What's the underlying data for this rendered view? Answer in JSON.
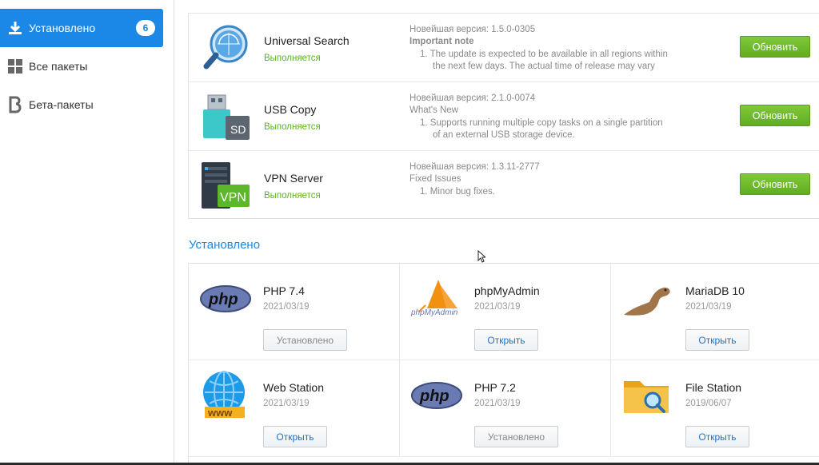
{
  "sidebar": {
    "items": [
      {
        "label": "Установлено",
        "badge": "6",
        "icon": "download-icon",
        "active": true
      },
      {
        "label": "Все пакеты",
        "icon": "grid-icon",
        "active": false
      },
      {
        "label": "Бета-пакеты",
        "icon": "beta-icon",
        "active": false
      }
    ]
  },
  "updates": [
    {
      "name": "Universal Search",
      "status": "Выполняется",
      "icon": "universal-search-icon",
      "notes": [
        "Новейшая версия: 1.5.0-0305",
        "Important note",
        "1. The update is expected to be available in all regions within",
        "the next few days. The actual time of release may vary"
      ],
      "button": "Обновить"
    },
    {
      "name": "USB Copy",
      "status": "Выполняется",
      "icon": "usb-copy-icon",
      "notes": [
        "Новейшая версия: 2.1.0-0074",
        "What's New",
        "1. Supports running multiple copy tasks on a single partition",
        "of an external USB storage device."
      ],
      "button": "Обновить"
    },
    {
      "name": "VPN Server",
      "status": "Выполняется",
      "icon": "vpn-server-icon",
      "notes": [
        "Новейшая версия: 1.3.11-2777",
        "Fixed Issues",
        "1. Minor bug fixes."
      ],
      "button": "Обновить"
    }
  ],
  "installed_section": {
    "title": "Установлено",
    "packages": [
      {
        "name": "PHP 7.4",
        "date": "2021/03/19",
        "button": "Установлено",
        "icon": "php-icon"
      },
      {
        "name": "phpMyAdmin",
        "date": "2021/03/19",
        "button": "Открыть",
        "icon": "phpmyadmin-icon"
      },
      {
        "name": "MariaDB 10",
        "date": "2021/03/19",
        "button": "Открыть",
        "icon": "mariadb-icon"
      },
      {
        "name": "Web Station",
        "date": "2021/03/19",
        "button": "Открыть",
        "icon": "web-station-icon"
      },
      {
        "name": "PHP 7.2",
        "date": "2021/03/19",
        "button": "Установлено",
        "icon": "php-icon"
      },
      {
        "name": "File Station",
        "date": "2019/06/07",
        "button": "Открыть",
        "icon": "file-station-icon"
      }
    ]
  },
  "colors": {
    "accent": "#1b87e6",
    "running": "#5db51e",
    "update_button": "#6fb92a"
  }
}
